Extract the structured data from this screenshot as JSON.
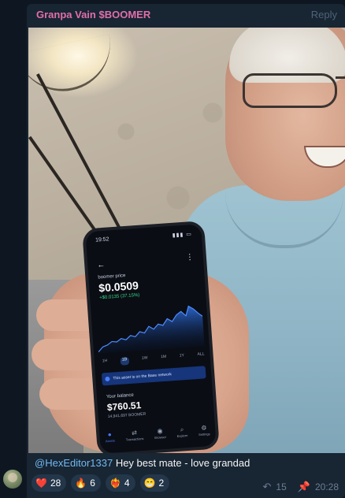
{
  "message": {
    "sender": "Granpa Vain $BOOMER",
    "reply_label": "Reply",
    "caption_mention": "@HexEditor1337",
    "caption_text": " Hey best mate - love grandad",
    "reactions": [
      {
        "emoji": "❤️",
        "count": "28"
      },
      {
        "emoji": "🔥",
        "count": "6"
      },
      {
        "emoji": "❤️‍🔥",
        "count": "4"
      },
      {
        "emoji": "😁",
        "count": "2"
      }
    ],
    "forwards": "15",
    "time": "20:28"
  },
  "phone": {
    "status_time": "19:52",
    "status_icons": "▮▮▮ ▭",
    "label": "boomer price",
    "price": "$0.0509",
    "change": "+$0.0135 (37.15%)",
    "ranges": [
      "1H",
      "1D",
      "1W",
      "1M",
      "1Y",
      "ALL"
    ],
    "active_range": "1D",
    "banner": "This asset is on the Base network",
    "balance_label": "Your balance",
    "balance": "$760.51",
    "balance_sub": "14,941,697 BOOMER",
    "nav": [
      {
        "icon": "home-icon",
        "label": "Assets"
      },
      {
        "icon": "transactions-icon",
        "label": "Transactions"
      },
      {
        "icon": "browser-icon",
        "label": "Browser"
      },
      {
        "icon": "explore-icon",
        "label": "Explore"
      },
      {
        "icon": "settings-icon",
        "label": "Settings"
      }
    ],
    "chart_color": "#2f6fe0"
  },
  "colors": {
    "background": "#0e1621",
    "bubble": "#182533",
    "sender": "#e06faa",
    "mention": "#71baf2",
    "reaction_bg": "#23364a"
  }
}
